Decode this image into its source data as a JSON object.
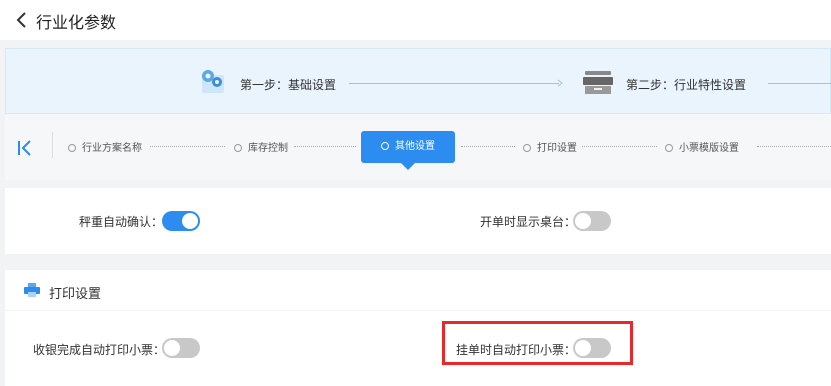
{
  "header": {
    "title": "行业化参数",
    "back_icon": "chevron-left-icon"
  },
  "steps": [
    {
      "label": "第一步：基础设置",
      "icon": "gear-icon"
    },
    {
      "label": "第二步：行业特性设置",
      "icon": "box-icon"
    }
  ],
  "tabs": {
    "collapse_icon": "collapse-left-icon",
    "items": [
      "行业方案名称",
      "库存控制",
      "其他设置",
      "打印设置",
      "小票模版设置"
    ],
    "active": "其他设置"
  },
  "other_settings": {
    "scale_confirm": {
      "label": "秤重自动确认：",
      "value": true
    },
    "show_table": {
      "label": "开单时显示桌台：",
      "value": false
    }
  },
  "print_section": {
    "title": "打印设置",
    "icon": "printer-icon",
    "cashier_print": {
      "label": "收银完成自动打印小票：",
      "value": false
    },
    "hang_print": {
      "label": "挂单时自动打印小票：",
      "value": false
    }
  },
  "colors": {
    "accent": "#2d8cf0",
    "highlight": "#e8282b",
    "toggle_off": "#c8c8c8"
  }
}
